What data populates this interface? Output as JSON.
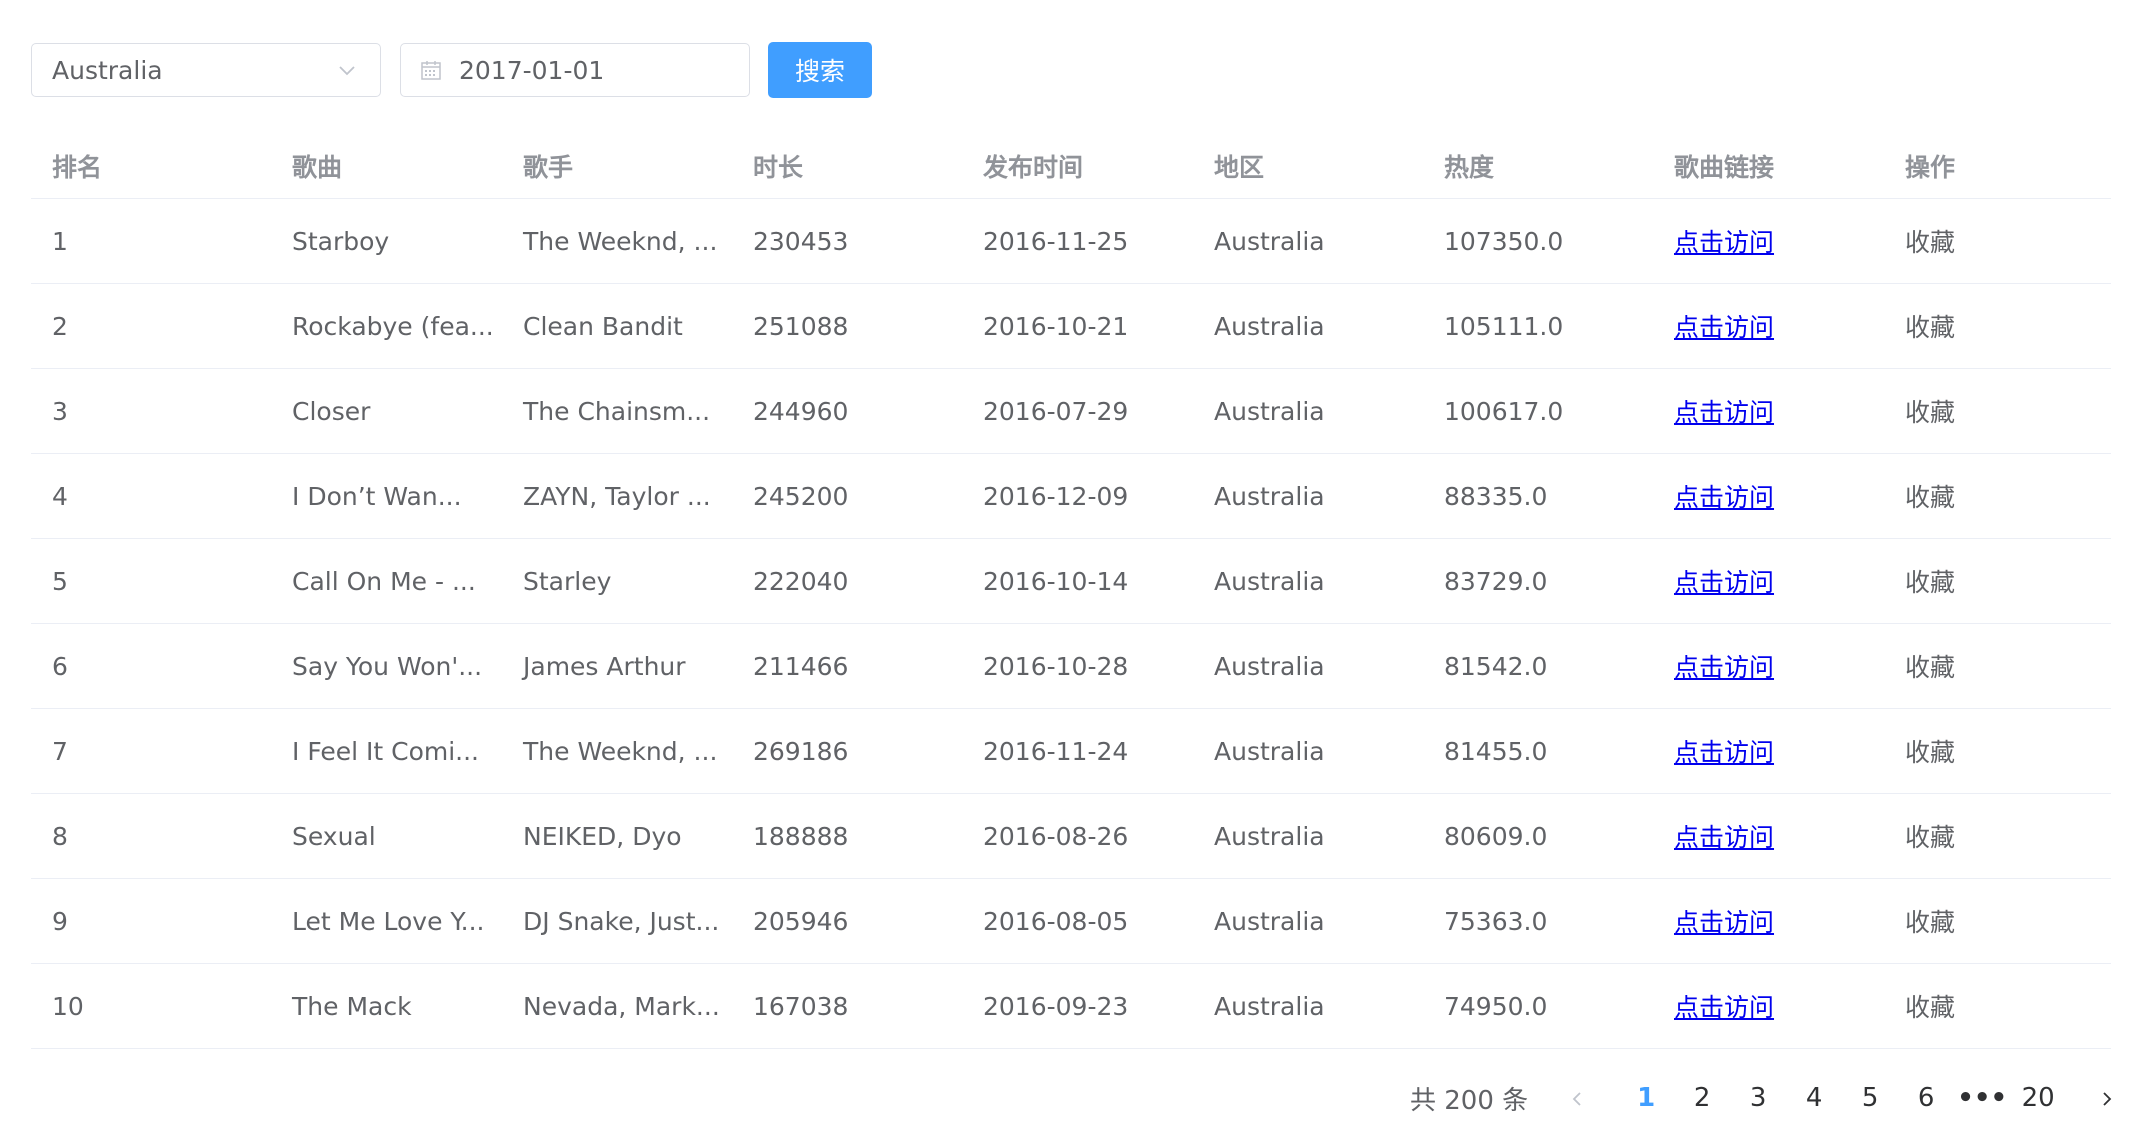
{
  "filters": {
    "region_value": "Australia",
    "date_value": "2017-01-01",
    "search_label": "搜索"
  },
  "table": {
    "columns": [
      "排名",
      "歌曲",
      "歌手",
      "时长",
      "发布时间",
      "地区",
      "热度",
      "歌曲链接",
      "操作"
    ],
    "rows": [
      [
        "1",
        "Starboy",
        "The Weeknd, ...",
        "230453",
        "2016-11-25",
        "Australia",
        "107350.0",
        "点击访问",
        "收藏"
      ],
      [
        "2",
        "Rockabye (fea...",
        "Clean Bandit",
        "251088",
        "2016-10-21",
        "Australia",
        "105111.0",
        "点击访问",
        "收藏"
      ],
      [
        "3",
        "Closer",
        "The Chainsm...",
        "244960",
        "2016-07-29",
        "Australia",
        "100617.0",
        "点击访问",
        "收藏"
      ],
      [
        "4",
        "I Don’t Wan...",
        "ZAYN, Taylor ...",
        "245200",
        "2016-12-09",
        "Australia",
        "88335.0",
        "点击访问",
        "收藏"
      ],
      [
        "5",
        "Call On Me - ...",
        "Starley",
        "222040",
        "2016-10-14",
        "Australia",
        "83729.0",
        "点击访问",
        "收藏"
      ],
      [
        "6",
        "Say You Won'...",
        "James Arthur",
        "211466",
        "2016-10-28",
        "Australia",
        "81542.0",
        "点击访问",
        "收藏"
      ],
      [
        "7",
        "I Feel It Comi...",
        "The Weeknd, ...",
        "269186",
        "2016-11-24",
        "Australia",
        "81455.0",
        "点击访问",
        "收藏"
      ],
      [
        "8",
        "Sexual",
        "NEIKED, Dyo",
        "188888",
        "2016-08-26",
        "Australia",
        "80609.0",
        "点击访问",
        "收藏"
      ],
      [
        "9",
        "Let Me Love Y...",
        "DJ Snake, Just...",
        "205946",
        "2016-08-05",
        "Australia",
        "75363.0",
        "点击访问",
        "收藏"
      ],
      [
        "10",
        "The Mack",
        "Nevada, Mark...",
        "167038",
        "2016-09-23",
        "Australia",
        "74950.0",
        "点击访问",
        "收藏"
      ]
    ]
  },
  "pagination": {
    "total_text": "共 200 条",
    "pages": [
      "1",
      "2",
      "3",
      "4",
      "5",
      "6"
    ],
    "current": "1",
    "ellipsis": "•••",
    "last": "20"
  },
  "icons": {
    "dropdown": "chevron-down-icon",
    "date": "calendar-icon",
    "prev": "chevron-left-icon",
    "next": "chevron-right-icon"
  },
  "colors": {
    "primary": "#409eff",
    "link": "#0000ee",
    "text": "#606266",
    "header_text": "#909399",
    "border": "#dcdfe6"
  }
}
